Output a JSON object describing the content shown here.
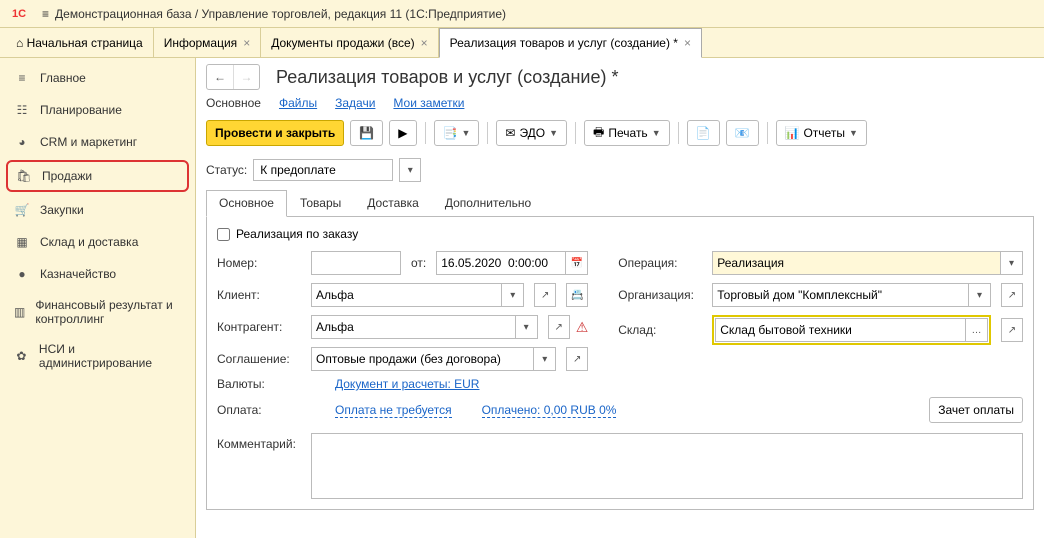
{
  "titlebar": {
    "app_title": "Демонстрационная база / Управление торговлей, редакция 11  (1С:Предприятие)"
  },
  "tabs": {
    "home": "Начальная страница",
    "info": "Информация",
    "docs": "Документы продажи (все)",
    "current": "Реализация товаров и услуг (создание) *"
  },
  "sidebar": {
    "items": [
      {
        "label": "Главное"
      },
      {
        "label": "Планирование"
      },
      {
        "label": "CRM и маркетинг"
      },
      {
        "label": "Продажи"
      },
      {
        "label": "Закупки"
      },
      {
        "label": "Склад и доставка"
      },
      {
        "label": "Казначейство"
      },
      {
        "label": "Финансовый результат и контроллинг"
      },
      {
        "label": "НСИ и администрирование"
      }
    ]
  },
  "page": {
    "title": "Реализация товаров и услуг (создание) *",
    "subtabs": {
      "main": "Основное",
      "files": "Файлы",
      "tasks": "Задачи",
      "notes": "Мои заметки"
    },
    "toolbar": {
      "post_close": "Провести и закрыть",
      "edo": "ЭДО",
      "print": "Печать",
      "reports": "Отчеты"
    },
    "status_label": "Статус:",
    "status_value": "К предоплате",
    "inner_tabs": {
      "main": "Основное",
      "goods": "Товары",
      "delivery": "Доставка",
      "extra": "Дополнительно"
    },
    "check_label": "Реализация по заказу",
    "fields": {
      "number_label": "Номер:",
      "number_value": "",
      "from_label": "от:",
      "date_value": "16.05.2020  0:00:00",
      "client_label": "Клиент:",
      "client_value": "Альфа",
      "contragent_label": "Контрагент:",
      "contragent_value": "Альфа",
      "agreement_label": "Соглашение:",
      "agreement_value": "Оптовые продажи (без договора)",
      "operation_label": "Операция:",
      "operation_value": "Реализация",
      "org_label": "Организация:",
      "org_value": "Торговый дом \"Комплексный\"",
      "store_label": "Склад:",
      "store_value": "Склад бытовой техники"
    },
    "currency_label": "Валюты:",
    "currency_link": "Документ и расчеты: EUR",
    "pay_label": "Оплата:",
    "pay_link": "Оплата не требуется",
    "paid_link": "Оплачено: 0,00 RUB  0%",
    "pay_button": "Зачет оплаты",
    "comment_label": "Комментарий:",
    "comment_value": ""
  }
}
